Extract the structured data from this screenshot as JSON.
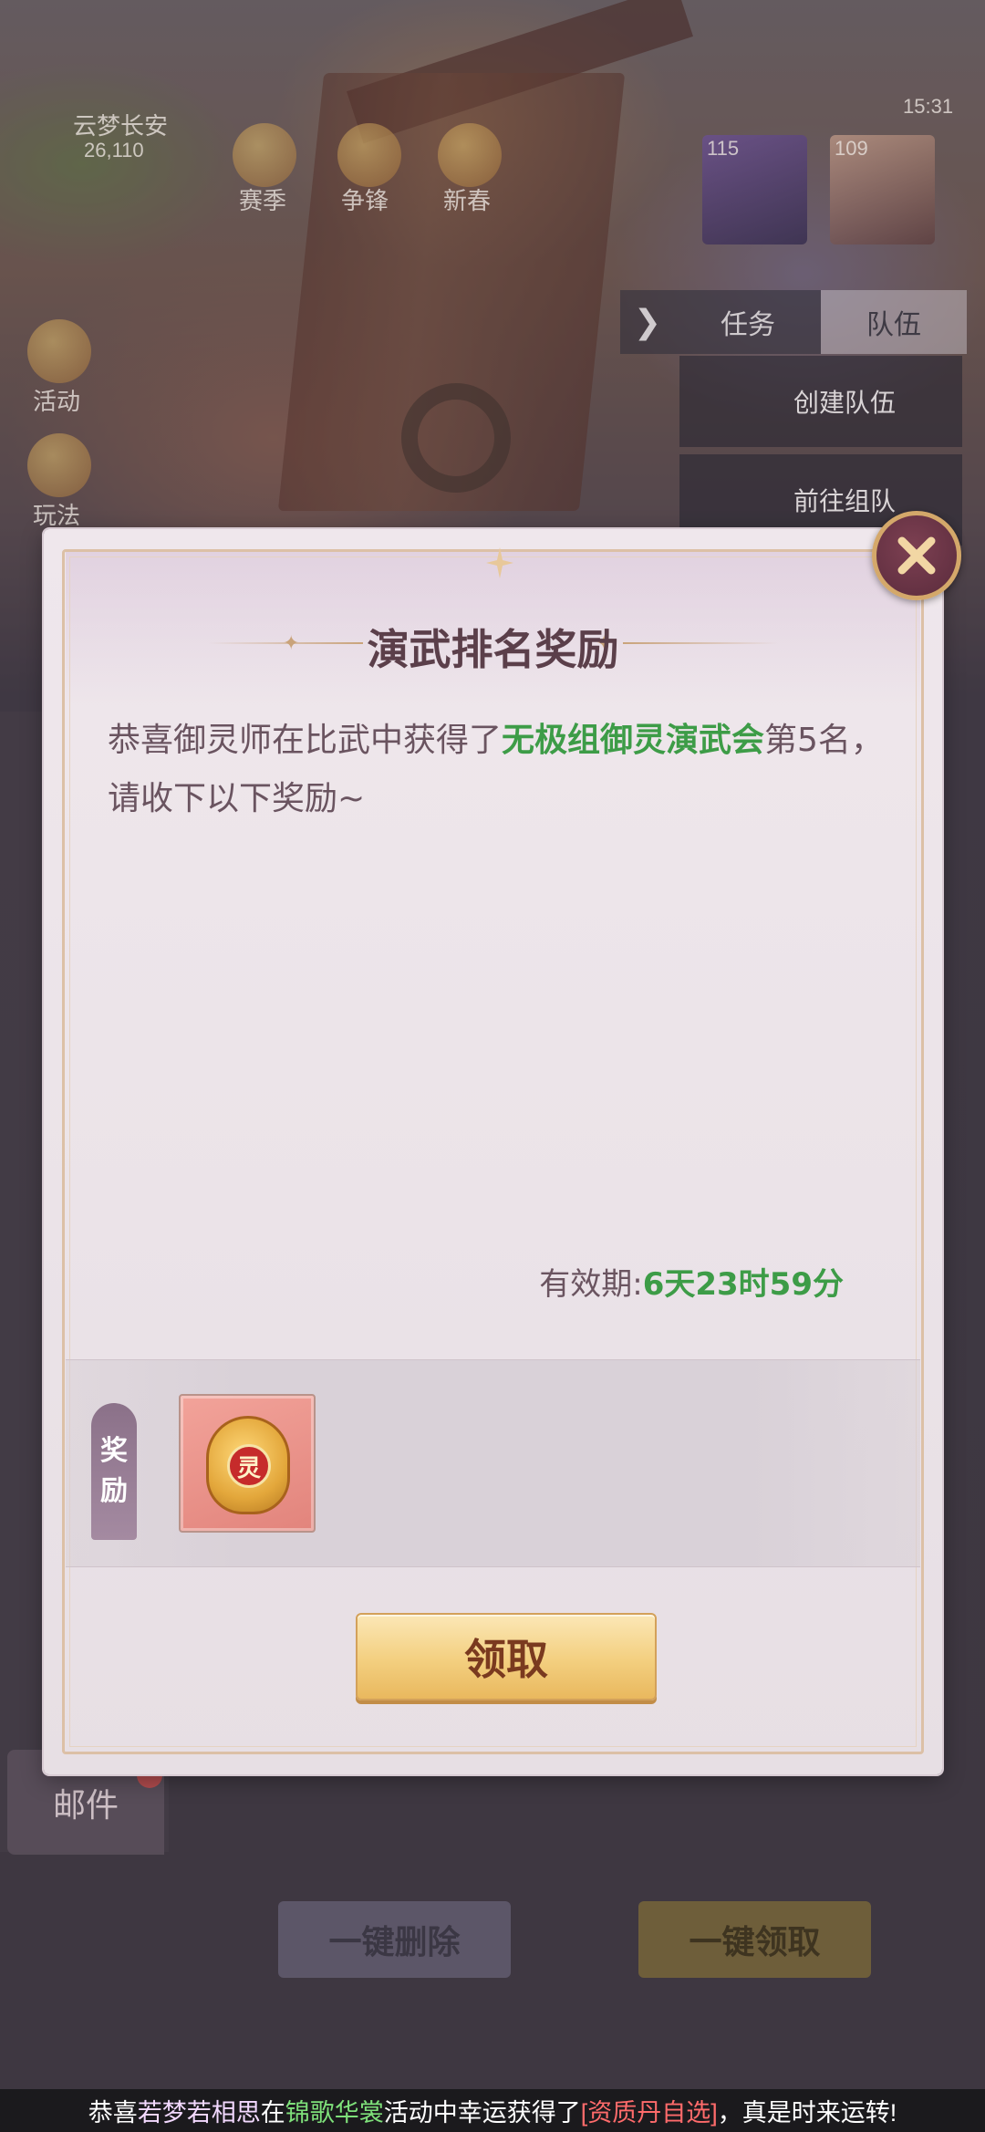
{
  "background": {
    "location_name": "云梦长安",
    "coords": "26,110",
    "top_icons": [
      "赛季",
      "争锋",
      "新春"
    ],
    "left_icons": [
      "活动",
      "玩法"
    ],
    "portraits": [
      {
        "level": "115"
      },
      {
        "level": "109"
      }
    ],
    "clock": "15:31",
    "tabs": [
      "任务",
      "队伍"
    ],
    "team_menu": [
      "创建队伍",
      "前往组队"
    ],
    "mail_tab": "邮件",
    "delete_all": "一键删除",
    "claim_all": "一键领取"
  },
  "dialog": {
    "title": "演武排名奖励",
    "message_prefix": "恭喜御灵师在比武中获得了",
    "message_highlight": "无极组御灵演武会",
    "message_suffix": "第5名，请收下以下奖励~",
    "validity_label": "有效期:",
    "validity_value": "6天23时59分",
    "reward_label_top": "奖",
    "reward_label_bottom": "励",
    "reward_item_glyph": "灵",
    "claim_label": "领取"
  },
  "marquee": {
    "p1": "恭喜",
    "name": "若梦若相思",
    "p2": "在",
    "event": "锦歌华裳",
    "p3": "活动中幸运获得了",
    "item": "[资质丹自选]",
    "p4": "，真是时来运转!"
  },
  "colors": {
    "highlight_green": "#3d9c47",
    "title": "#5b3f4a",
    "claim_button": "#f3cf7f"
  }
}
